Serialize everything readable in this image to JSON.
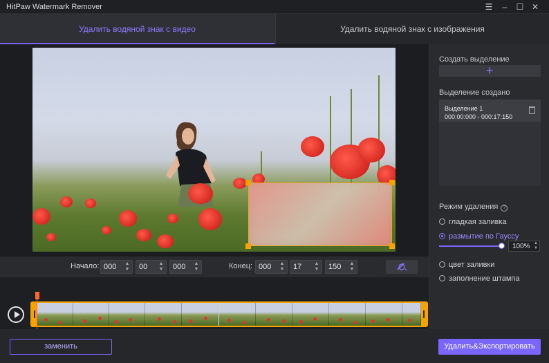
{
  "window": {
    "title": "HitPaw Watermark Remover",
    "minimize_glyph": "–",
    "maximize_glyph": "☐",
    "close_glyph": "✕",
    "menu_glyph": "☰"
  },
  "tabs": [
    {
      "label": "Удалить водяной знак с видео",
      "active": true
    },
    {
      "label": "Удалить водяной знак с изображения",
      "active": false
    }
  ],
  "time": {
    "start_label": "Начало:",
    "start": [
      "000",
      "00",
      "000"
    ],
    "end_label": "Конец:",
    "end": [
      "000",
      "17",
      "150"
    ]
  },
  "right_panel": {
    "create_selection_label": "Создать выделение",
    "selection_created_label": "Выделение создано",
    "selections": [
      {
        "name": "Выделение 1",
        "range": "000:00:000 - 000:17:150"
      }
    ],
    "removal_mode_label": "Режим удаления",
    "modes": [
      {
        "label": "гладкая заливка",
        "selected": false
      },
      {
        "label": "размытие по Гауссу",
        "selected": true
      },
      {
        "label": "цвет заливки",
        "selected": false
      },
      {
        "label": "заполнение штампа",
        "selected": false
      }
    ],
    "blur_percent": "100%",
    "blur_level": 1.0
  },
  "buttons": {
    "replace": "заменить",
    "export": "Удалить&Экспортировать"
  },
  "colors": {
    "accent": "#7a66ff",
    "selection_box": "#f5a300",
    "playhead": "#ff6a2a"
  }
}
